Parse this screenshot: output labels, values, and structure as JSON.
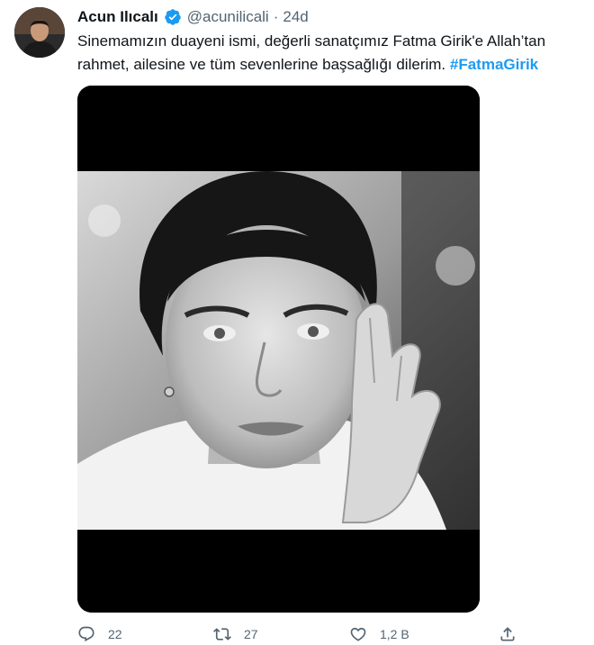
{
  "author": {
    "name": "Acun Ilıcalı",
    "handle": "@acunilicali",
    "separator": "·",
    "time": "24d",
    "verified": true
  },
  "tweet": {
    "text": "Sinemamızın duayeni ismi, değerli sanatçımız Fatma Girik'e Allah’tan rahmet, ailesine ve tüm sevenlerine başsağlığı dilerim.",
    "hashtag": "#FatmaGirik"
  },
  "actions": {
    "reply": {
      "icon": "reply-icon",
      "count": "22"
    },
    "retweet": {
      "icon": "retweet-icon",
      "count": "27"
    },
    "like": {
      "icon": "heart-icon",
      "count": "1,2 B"
    },
    "share": {
      "icon": "share-icon"
    }
  },
  "colors": {
    "text": "#0f1419",
    "secondary": "#536471",
    "accent": "#1d9bf0"
  }
}
